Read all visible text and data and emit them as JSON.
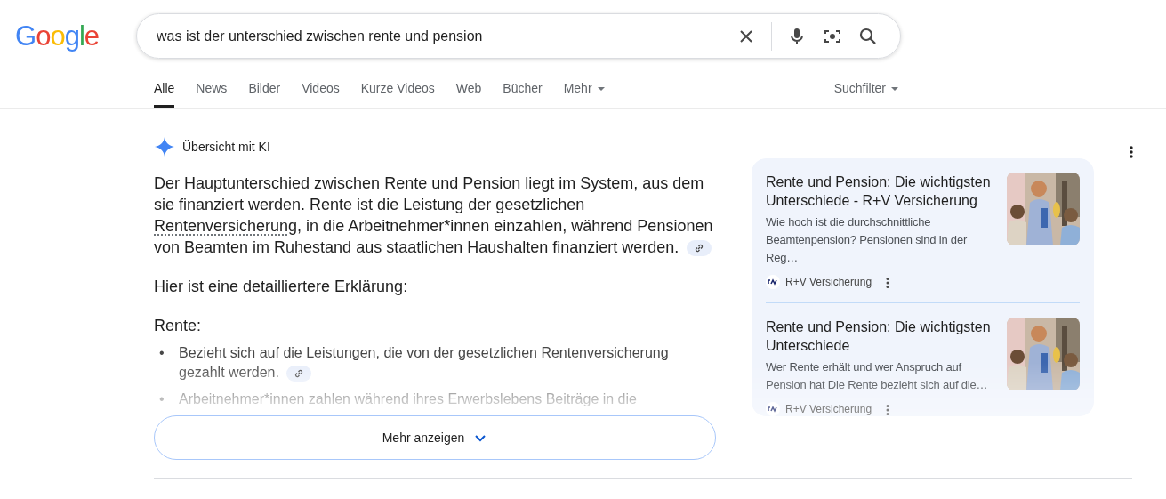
{
  "logo": {
    "text": "Google"
  },
  "search": {
    "value": "was ist der unterschied zwischen rente und pension"
  },
  "tabs": [
    {
      "label": "Alle",
      "selected": true,
      "dropdown": false
    },
    {
      "label": "News",
      "selected": false,
      "dropdown": false
    },
    {
      "label": "Bilder",
      "selected": false,
      "dropdown": false
    },
    {
      "label": "Videos",
      "selected": false,
      "dropdown": false
    },
    {
      "label": "Kurze Videos",
      "selected": false,
      "dropdown": false
    },
    {
      "label": "Web",
      "selected": false,
      "dropdown": false
    },
    {
      "label": "Bücher",
      "selected": false,
      "dropdown": false
    },
    {
      "label": "Mehr",
      "selected": false,
      "dropdown": true
    }
  ],
  "filter": {
    "label": "Suchfilter"
  },
  "ai_overview": {
    "title": "Übersicht mit KI",
    "intro": {
      "before": "Der Hauptunterschied zwischen Rente und Pension liegt im System, aus dem sie finanziert werden. Rente ist die Leistung der gesetzlichen ",
      "link": "Rentenversicherung",
      "after": ", in die Arbeitnehmer*innen einzahlen, während Pensionen von Beamten im Ruhestand aus staatlichen Haushalten finanziert werden.",
      "citation": true
    },
    "lead": "Hier ist eine detailliertere Erklärung:",
    "heading": "Rente:",
    "bullets": [
      {
        "marker": "•",
        "text": "Bezieht sich auf die Leistungen, die von der gesetzlichen Rentenversicherung gezahlt werden.",
        "citation": true
      },
      {
        "marker": "•",
        "text": "Arbeitnehmer*innen zahlen während ihres Erwerbslebens Beiträge in die",
        "citation": false
      }
    ],
    "more_button": "Mehr anzeigen"
  },
  "sources": [
    {
      "title": "Rente und Pension: Die wichtigsten Unterschiede - R+V Versicherung",
      "snippet": "Wie hoch ist die durchschnittliche Beamtenpension? Pensionen sind in der Reg…",
      "site": "R+V Versicherung"
    },
    {
      "title": "Rente und Pension: Die wichtigsten Unterschiede",
      "snippet": "Wer Rente erhält und wer Anspruch auf Pension hat Die Rente bezieht sich auf die…",
      "site": "R+V Versicherung"
    }
  ]
}
